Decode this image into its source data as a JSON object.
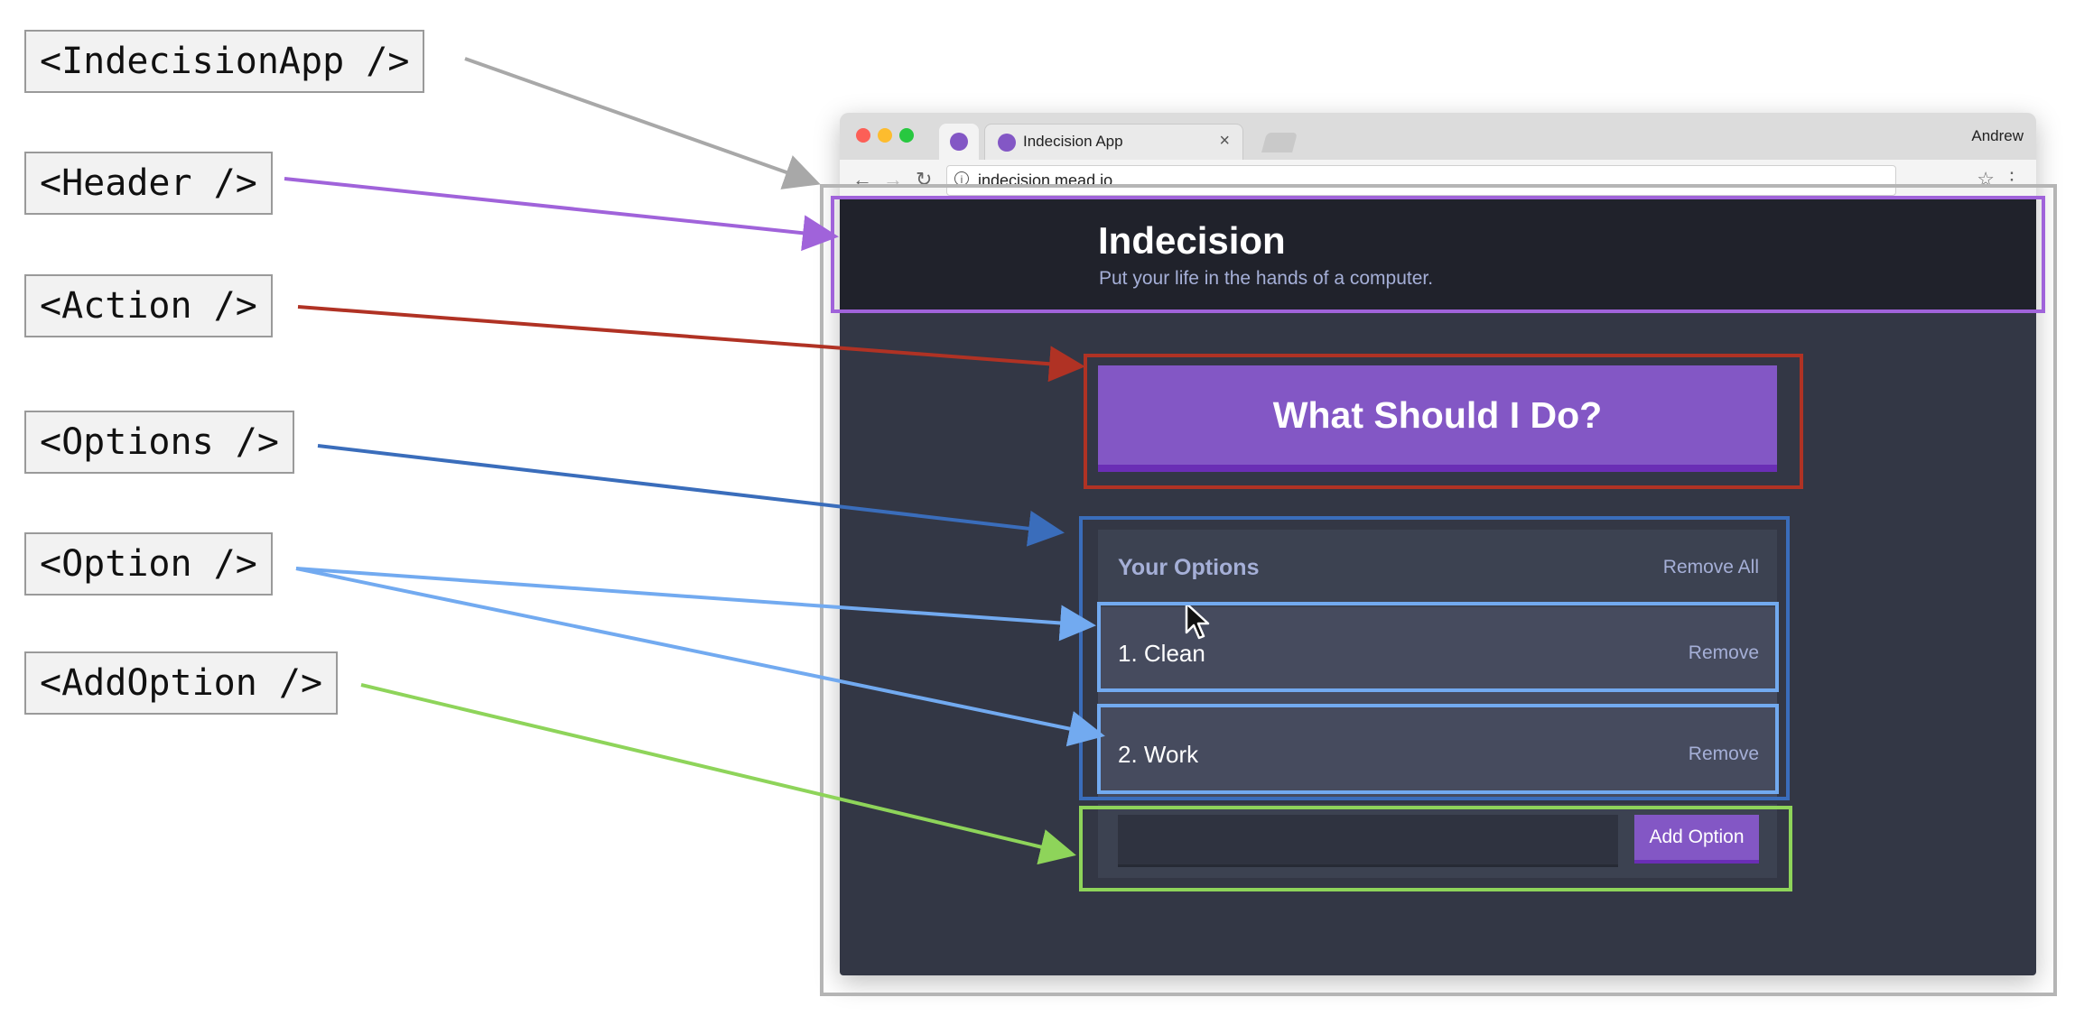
{
  "labels": {
    "indecision_app": "<IndecisionApp />",
    "header": "<Header />",
    "action": "<Action />",
    "options": "<Options />",
    "option": "<Option />",
    "add_option": "<AddOption />"
  },
  "browser": {
    "tab_title": "Indecision App",
    "tab_close": "×",
    "profile_name": "Andrew",
    "url": "indecision.mead.io"
  },
  "app": {
    "title": "Indecision",
    "subtitle": "Put your life in the hands of a computer.",
    "action_button": "What Should I Do?",
    "options_title": "Your Options",
    "remove_all": "Remove All",
    "options": [
      {
        "text": "1. Clean",
        "remove": "Remove"
      },
      {
        "text": "2. Work",
        "remove": "Remove"
      }
    ],
    "add_option_input_value": "",
    "add_option_button": "Add Option"
  },
  "colors": {
    "header_bg": "#20222b",
    "app_bg": "#333745",
    "purple": "#8357c5",
    "subtitle": "#a5afd7",
    "highlight_app": "#b5b5b5",
    "highlight_header": "#a063da",
    "highlight_action": "#b03224",
    "highlight_options": "#3a6dbb",
    "highlight_option": "#72aaf0",
    "highlight_add": "#8ed45a"
  },
  "icons": {
    "back": "arrow-left-icon",
    "forward": "arrow-right-icon",
    "reload": "reload-icon",
    "info": "info-icon",
    "bookmark": "star-icon",
    "menu": "kebab-menu-icon",
    "cursor": "mouse-cursor-icon"
  }
}
